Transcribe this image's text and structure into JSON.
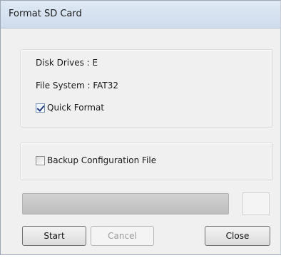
{
  "dialog": {
    "title": "Format SD Card"
  },
  "info": {
    "disk_drives": "Disk Drives : E",
    "file_system": "File System : FAT32"
  },
  "options": {
    "quick_format": {
      "label": "Quick Format",
      "checked": true
    },
    "backup_config": {
      "label": "Backup Configuration File",
      "checked": false
    }
  },
  "progress": {
    "value": 0,
    "text": ""
  },
  "buttons": {
    "start": "Start",
    "cancel": "Cancel",
    "close": "Close"
  },
  "colors": {
    "titlebar": "#d6e2f0",
    "progress_fill": "#4cb64c"
  }
}
